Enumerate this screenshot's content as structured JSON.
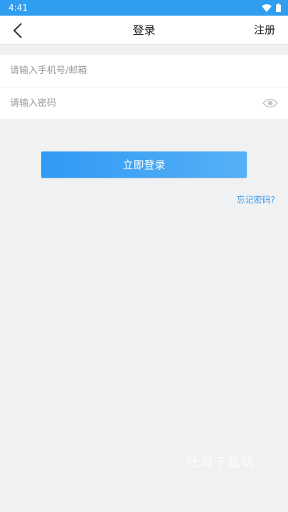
{
  "status_bar": {
    "time": "4:41",
    "icons": [
      "wifi-icon",
      "battery-icon"
    ],
    "background": "#2f9df0"
  },
  "header": {
    "back_icon": "chevron-left-icon",
    "title": "登录",
    "register_label": "注册"
  },
  "form": {
    "account_placeholder": "请输入手机号/邮箱",
    "account_value": "",
    "password_placeholder": "请输入密码",
    "password_value": "",
    "visibility_icon": "eye-icon"
  },
  "actions": {
    "login_label": "立即登录",
    "login_color": "#3a9ff5",
    "forgot_label": "忘记密码?",
    "forgot_color": "#3b9be6"
  },
  "watermark": "吐司下载站"
}
